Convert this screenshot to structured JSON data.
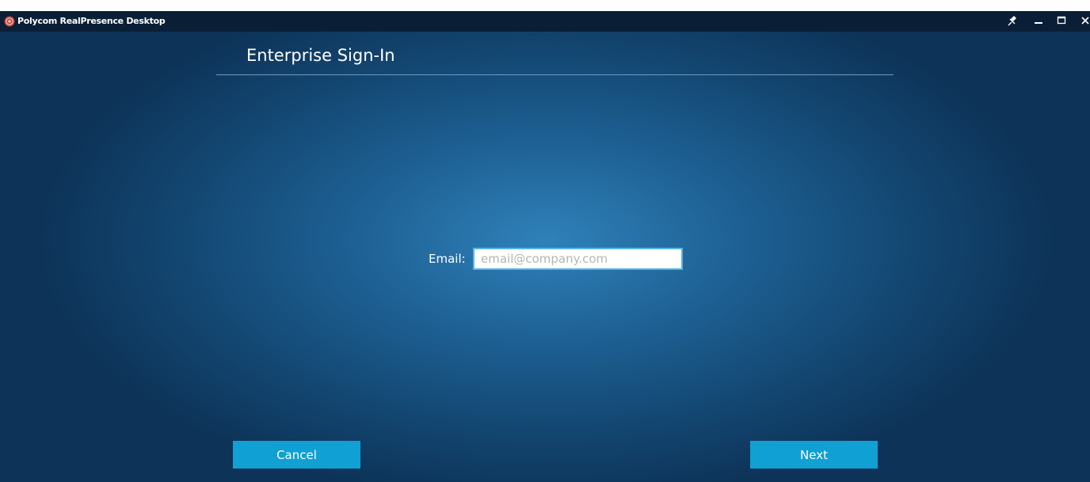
{
  "app": {
    "title": "Polycom RealPresence Desktop",
    "logo_icon": "polycom-logo-icon"
  },
  "window_controls": {
    "pin_icon": "pin-icon",
    "minimize_icon": "minimize-icon",
    "maximize_icon": "maximize-icon",
    "close_icon": "close-icon"
  },
  "header": {
    "title": "Enterprise Sign-In"
  },
  "form": {
    "email_label": "Email:",
    "email_value": "",
    "email_placeholder": "email@company.com"
  },
  "buttons": {
    "cancel_label": "Cancel",
    "next_label": "Next"
  },
  "colors": {
    "titlebar": "#0a1f36",
    "background_center": "#2f81b9",
    "background_edge": "#0d3358",
    "button": "#10a0d4",
    "input_border": "#5ab4e6",
    "divider": "#6f9bbd"
  }
}
